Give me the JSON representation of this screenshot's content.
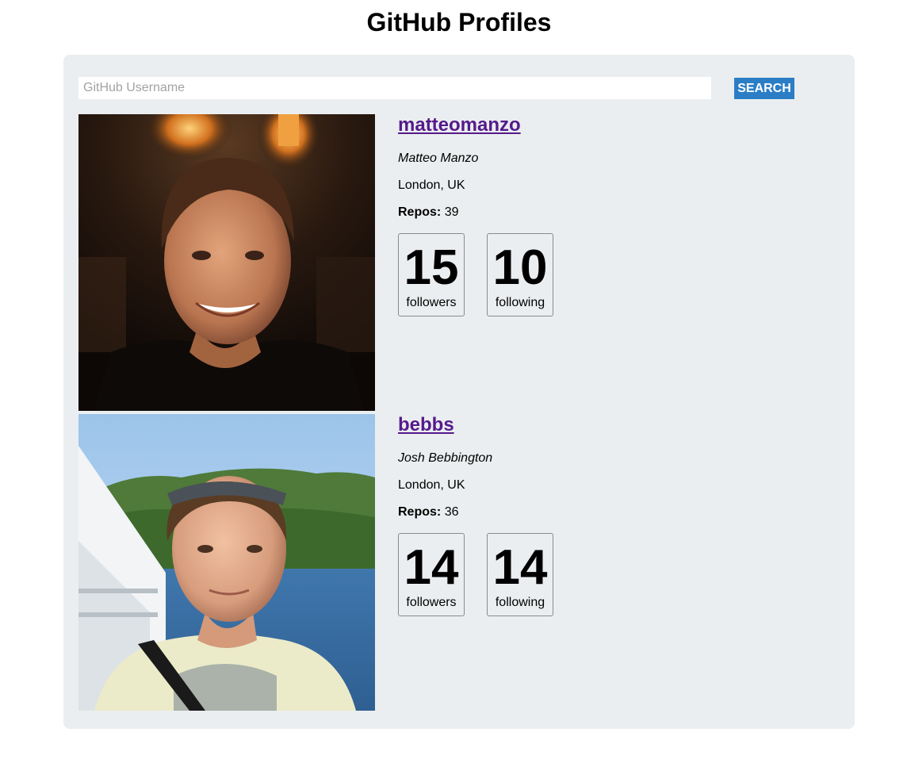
{
  "page": {
    "title": "GitHub Profiles"
  },
  "search": {
    "placeholder": "GitHub Username",
    "value": "",
    "button_label": "SEARCH"
  },
  "colors": {
    "panel_background": "#ebeef0",
    "button": "#2b7ec6",
    "link": "#551a8b"
  },
  "profiles": [
    {
      "username": "matteomanzo",
      "name": "Matteo Manzo",
      "location": "London, UK",
      "repos_label": "Repos:",
      "repos": "39",
      "followers": "15",
      "followers_label": "followers",
      "following": "10",
      "following_label": "following",
      "avatar": "avatar-photo"
    },
    {
      "username": "bebbs",
      "name": "Josh Bebbington",
      "location": "London, UK",
      "repos_label": "Repos:",
      "repos": "36",
      "followers": "14",
      "followers_label": "followers",
      "following": "14",
      "following_label": "following",
      "avatar": "avatar-photo"
    }
  ]
}
